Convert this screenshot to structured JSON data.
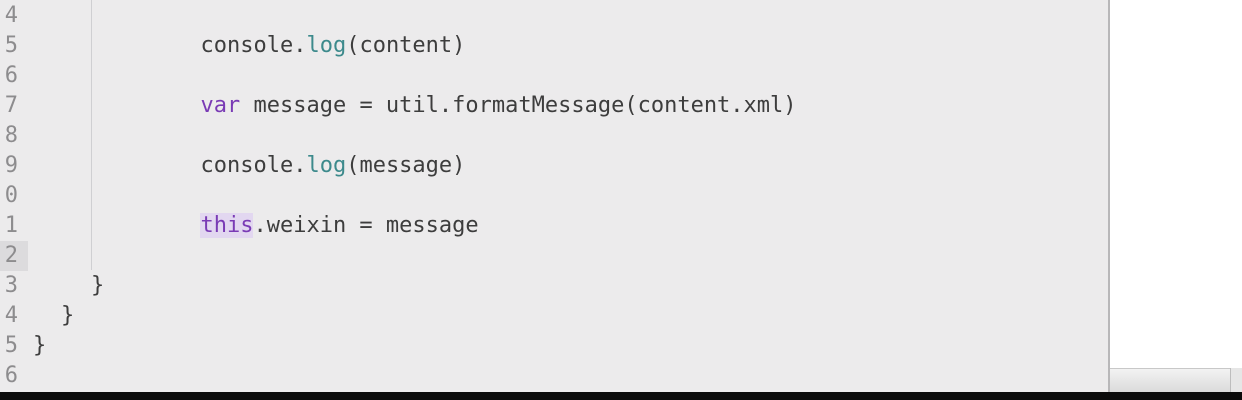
{
  "editor": {
    "lines": [
      {
        "num": "4",
        "code": "console.log(content)"
      },
      {
        "num": "5",
        "code": ""
      },
      {
        "num": "6",
        "code": "var message = util.formatMessage(content.xml)"
      },
      {
        "num": "7",
        "code": ""
      },
      {
        "num": "8",
        "code": "console.log(message)"
      },
      {
        "num": "9",
        "code": ""
      },
      {
        "num": "0",
        "code": "this.weixin = message"
      },
      {
        "num": "1",
        "code": ""
      },
      {
        "num": "2",
        "code": ""
      },
      {
        "num": "3",
        "code": "}"
      },
      {
        "num": "4",
        "code": "}"
      },
      {
        "num": "5",
        "code": "}"
      },
      {
        "num": "6",
        "code": ""
      }
    ],
    "tokens": {
      "console": "console",
      "dot": ".",
      "log": "log",
      "paren_content": "(content)",
      "paren_message": "(message)",
      "var_kw": "var",
      "message_assign": " message = util.formatMessage(content.xml)",
      "this_kw": "this",
      "weixin_assign": ".weixin = message",
      "brace": "}"
    }
  },
  "colors": {
    "background": "#ecebec",
    "keyword": "#7a3bb5",
    "function": "#3d8a8c",
    "text": "#3d3d3d",
    "gutter": "#8d8c8e"
  }
}
